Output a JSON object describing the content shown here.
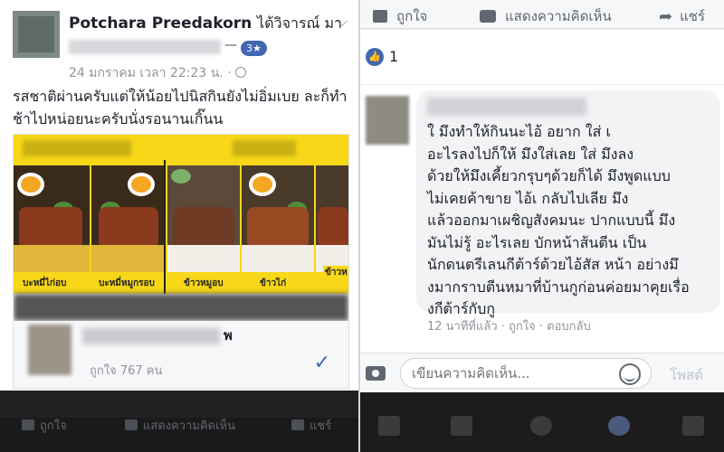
{
  "post": {
    "author": "Potchara Preedakorn",
    "author_action": "ได้วิจารณ์ มา",
    "badge": "3★",
    "timestamp": "24 มกราคม เวลา 22:23 น. ·",
    "text": "รสชาติผ่านครับแต่ให้น้อยไปนิสกินยังไม่อิ่มเบย  ละก็ทำช้าไปหน่อยนะครับนั่งรอนานเกิ๊นน",
    "food_labels": [
      "บะหมี่ไก่อบ",
      "บะหมี่หมูกรอบ",
      "ข้าวหมูอบ",
      "ข้าวไก่",
      "ข้าวห"
    ],
    "page_name_tail": "พ",
    "page_likes": "ถูกใจ 767 คน",
    "actions": [
      "ถูกใจ",
      "แสดงความคิดเห็น",
      "แชร์"
    ]
  },
  "right": {
    "actions": [
      "ถูกใจ",
      "แสดงความคิดเห็น",
      "แชร์"
    ],
    "like_count": "1",
    "comment_lines": [
      "ใ     มึงทำให้กินนะไอ้      อยาก ใส่ เ",
      "อะไรลงไปก็ให้       มึงใส่เลย ใส่      มึงลง",
      "ด้วยให้มึงเคี้ยวกรุบๆด้วยก็ได้ มึงพูดแบบ",
      "ไม่เคยค้าขาย ไอ้เ     กลับไปเลีย      มึง",
      "แล้วออกมาเผชิญสังคมนะ ปากแบบนี้ มึง",
      "มันไม่รู้       อะไรเลย บักหน้าส้นตีน เป็น",
      "นักดนตรีเลนกีต้าร์ด้วยไอ้สัส หน้า    อย่างมึ",
      "งมากราบตีนหมาที่บ้านกูก่อนค่อยมาคุยเรื่อ",
      "งกีต้าร์กับกู"
    ],
    "comment_meta": "12 นาทีที่แล้ว · ถูกใจ · ตอบกลับ",
    "compose_placeholder": "เขียนความคิดเห็น...",
    "post_button": "โพสต์"
  }
}
